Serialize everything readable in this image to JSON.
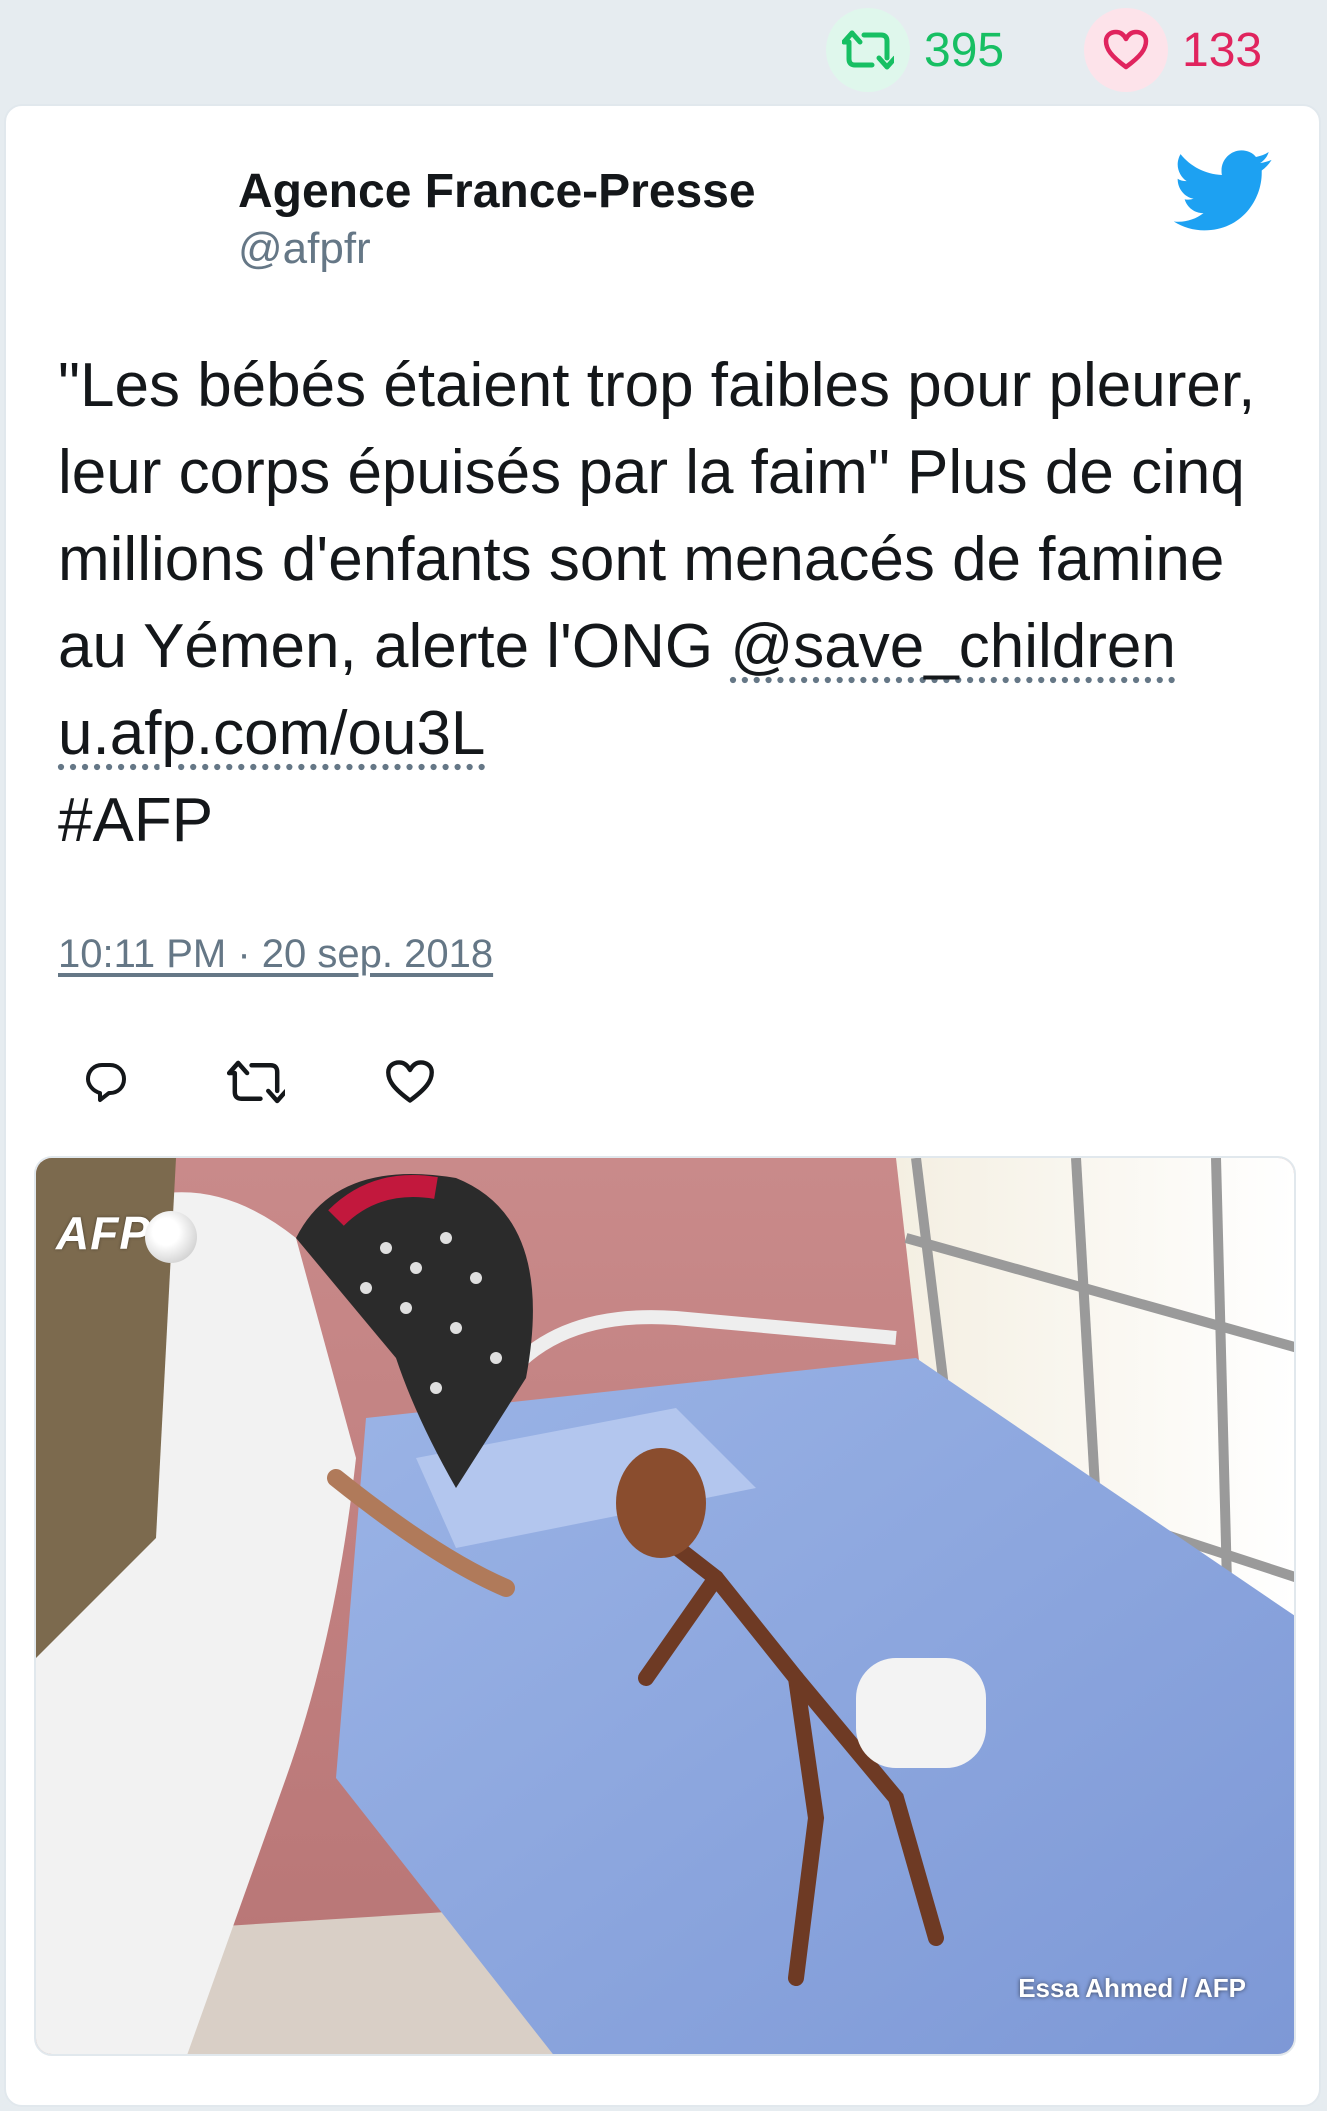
{
  "stats": {
    "retweets": "395",
    "likes": "133"
  },
  "author": {
    "name": "Agence France-Presse",
    "handle": "@afpfr"
  },
  "tweet": {
    "text_part1": "\"Les bébés étaient trop faibles pour pleurer, leur corps épuisés par la faim\" Plus de cinq millions d'enfants sont menacés de famine au Yémen, alerte l'ONG ",
    "mention": "@save_children",
    "space": " ",
    "url": "u.afp.com/ou3L",
    "hashtag": "#AFP",
    "timestamp": "10:11 PM · 20 sep. 2018"
  },
  "photo": {
    "logo_text": "AFP",
    "credit": "Essa Ahmed / AFP"
  },
  "colors": {
    "background": "#e6ecf0",
    "twitter_blue": "#1da1f2",
    "retweet_green": "#17bf63",
    "like_red": "#e0245e",
    "secondary_text": "#657786"
  },
  "icons": {
    "retweet": "retweet-icon",
    "like": "heart-icon",
    "reply": "reply-icon",
    "brand": "twitter-bird-icon"
  }
}
